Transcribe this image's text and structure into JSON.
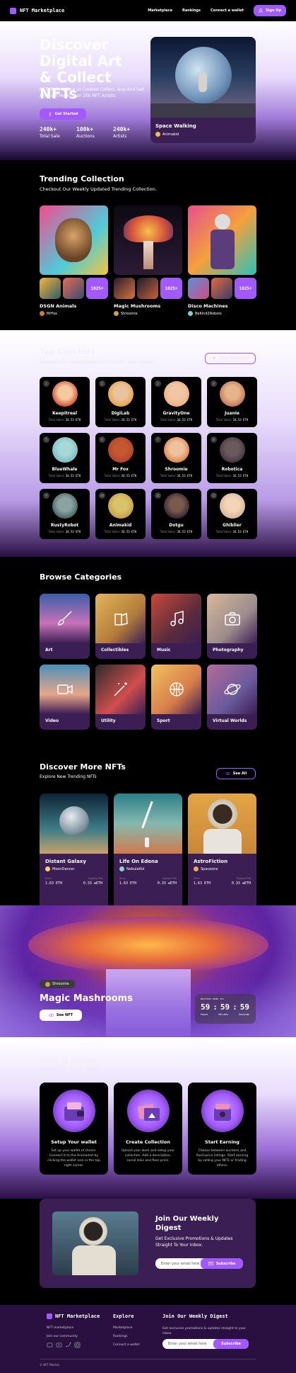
{
  "nav": {
    "brand": "NFT Marketplace",
    "links": [
      "Marketplace",
      "Rankings",
      "Connect a wallet"
    ],
    "signup": "Sign Up"
  },
  "hero": {
    "title": "Discover Digital Art & Collect NFTs",
    "subtitle": "NFT Marketplace UI Created Collect, Buy And Sell Art From More Than 20k NFT Artists.",
    "cta": "Get Started",
    "stats": [
      {
        "value": "240k+",
        "label": "Total Sale"
      },
      {
        "value": "100k+",
        "label": "Auctions"
      },
      {
        "value": "240k+",
        "label": "Artists"
      }
    ],
    "card_title": "Space Walking",
    "card_artist": "Animakid"
  },
  "trending": {
    "title": "Trending Collection",
    "subtitle": "Checkout Our Weekly Updated Trending Collection.",
    "collections": [
      {
        "name": "DSGN Animals",
        "artist": "MrFox",
        "more": "1025+"
      },
      {
        "name": "Magic Mushrooms",
        "artist": "Shroomie",
        "more": "1025+"
      },
      {
        "name": "Disco Machines",
        "artist": "BeKind2Robots",
        "more": "1025+"
      }
    ]
  },
  "creators": {
    "title": "Top Creators",
    "subtitle": "Checkout Top Rated Creators On The NFT Marketplace",
    "button": "View Rankings",
    "sales_label": "Total Sales:",
    "sales_value": "34.53 ETH",
    "items": [
      {
        "rank": "1",
        "name": "Keepitreal"
      },
      {
        "rank": "2",
        "name": "DigiLab"
      },
      {
        "rank": "3",
        "name": "GravityOne"
      },
      {
        "rank": "4",
        "name": "Juanie"
      },
      {
        "rank": "5",
        "name": "BlueWhale"
      },
      {
        "rank": "6",
        "name": "Mr Fox"
      },
      {
        "rank": "7",
        "name": "Shroomie"
      },
      {
        "rank": "8",
        "name": "Robotica"
      },
      {
        "rank": "9",
        "name": "RustyRobot"
      },
      {
        "rank": "10",
        "name": "Animakid"
      },
      {
        "rank": "11",
        "name": "Dotgu"
      },
      {
        "rank": "12",
        "name": "Ghiblier"
      }
    ]
  },
  "categories": {
    "title": "Browse Categories",
    "items": [
      {
        "label": "Art",
        "icon": "paintbrush-icon"
      },
      {
        "label": "Collectibles",
        "icon": "swatches-icon"
      },
      {
        "label": "Music",
        "icon": "music-note-icon"
      },
      {
        "label": "Photography",
        "icon": "camera-icon"
      },
      {
        "label": "Video",
        "icon": "video-camera-icon"
      },
      {
        "label": "Utility",
        "icon": "magic-wand-icon"
      },
      {
        "label": "Sport",
        "icon": "basketball-icon"
      },
      {
        "label": "Virtual Worlds",
        "icon": "planet-icon"
      }
    ]
  },
  "discover": {
    "title": "Discover More NFTs",
    "subtitle": "Explore New Trending NFTs",
    "button": "See All",
    "price_label": "Price",
    "bid_label": "Highest Bid",
    "items": [
      {
        "title": "Distant Galaxy",
        "artist": "MoonDancer",
        "price": "1.63 ETH",
        "bid": "0.33 wETH"
      },
      {
        "title": "Life On Edena",
        "artist": "NebulaKid",
        "price": "1.63 ETH",
        "bid": "0.33 wETH"
      },
      {
        "title": "AstroFiction",
        "artist": "Spaceone",
        "price": "1.63 ETH",
        "bid": "0.33 wETH"
      }
    ]
  },
  "banner": {
    "artist": "Shroomie",
    "title": "Magic Mashrooms",
    "button": "See NFT",
    "auction_label": "Auction ends in:",
    "hours": "59",
    "minutes": "59",
    "seconds": "59",
    "hours_label": "Hours",
    "minutes_label": "Minutes",
    "seconds_label": "Seconds"
  },
  "how": {
    "title": "How It Works",
    "subtitle": "Find Out How To Get Started",
    "steps": [
      {
        "title": "Setup Your wallet",
        "text": "Set up your wallet of choice. Connect it to the Animarket by clicking the wallet icon in the top right corner."
      },
      {
        "title": "Create Collection",
        "text": "Upload your work and setup your collection. Add a description, social links and floor price."
      },
      {
        "title": "Start Earning",
        "text": "Choose between auctions and fixed-price listings. Start earning by selling your NFTs or trading others."
      }
    ]
  },
  "subscribe": {
    "title": "Join Our Weekly Digest",
    "subtitle": "Get Exclusive Promotions & Updates Straight To Your Inbox.",
    "placeholder": "Enter your email here",
    "button": "Subscribe"
  },
  "footer": {
    "brand": "NFT Marketplace",
    "tagline": "NFT marketplace",
    "community": "Join our community",
    "explore_title": "Explore",
    "explore_links": [
      "Marketplace",
      "Rankings",
      "Connect a wallet"
    ],
    "digest_title": "Join Our Weekly Digest",
    "digest_text": "Get exclusive promotions & updates straight to your inbox.",
    "placeholder": "Enter your email here",
    "button": "Subscribe",
    "copyright": "© NFT Market."
  }
}
